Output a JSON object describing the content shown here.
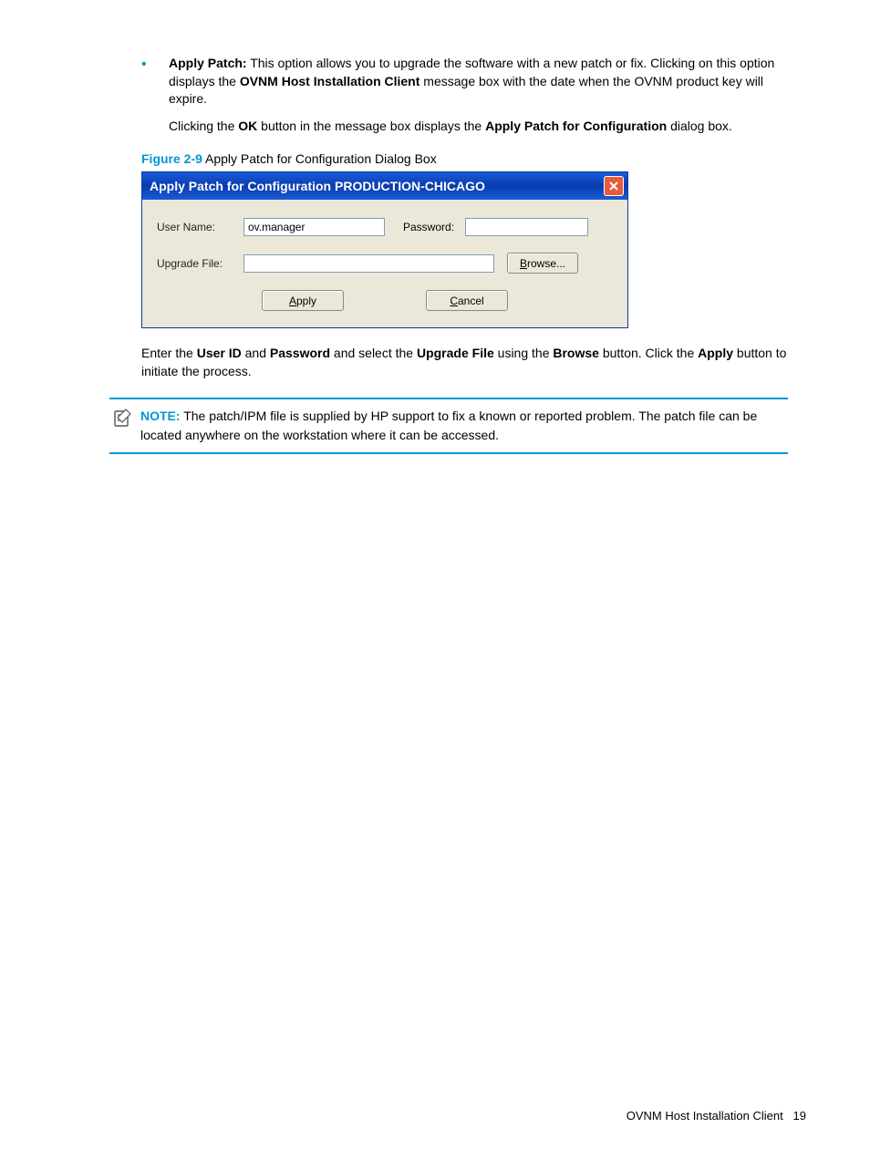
{
  "bullet": {
    "heading": "Apply Patch:",
    "text1": " This option allows you to upgrade the software with a new patch or fix. Clicking on this option displays the ",
    "bold1": "OVNM Host Installation Client",
    "text2": " message box with the date when the OVNM product key will expire.",
    "para2a": "Clicking the ",
    "para2b": "OK",
    "para2c": " button in the message box displays the ",
    "para2d": "Apply Patch for Configuration",
    "para2e": " dialog box."
  },
  "figure": {
    "label": "Figure 2-9",
    "caption": " Apply Patch for Configuration Dialog Box"
  },
  "dialog": {
    "title": "Apply Patch for Configuration PRODUCTION-CHICAGO",
    "username_label": "User Name:",
    "username_value": "ov.manager",
    "password_label": "Password:",
    "upgradefile_label": "Upgrade File:",
    "browse": "Browse...",
    "apply": "Apply",
    "cancel": "Cancel"
  },
  "instruction": {
    "t1": "Enter the ",
    "b1": "User ID",
    "t2": " and ",
    "b2": "Password",
    "t3": " and select the ",
    "b3": "Upgrade File",
    "t4": " using the ",
    "b4": "Browse",
    "t5": " button. Click the ",
    "b5": "Apply",
    "t6": " button to initiate the process."
  },
  "note": {
    "label": "NOTE:",
    "text": "  The patch/IPM file is supplied by HP support to fix a known or reported problem. The patch file can be located anywhere on the workstation where it can be accessed."
  },
  "footer": {
    "text": "OVNM Host Installation Client",
    "page": "19"
  }
}
